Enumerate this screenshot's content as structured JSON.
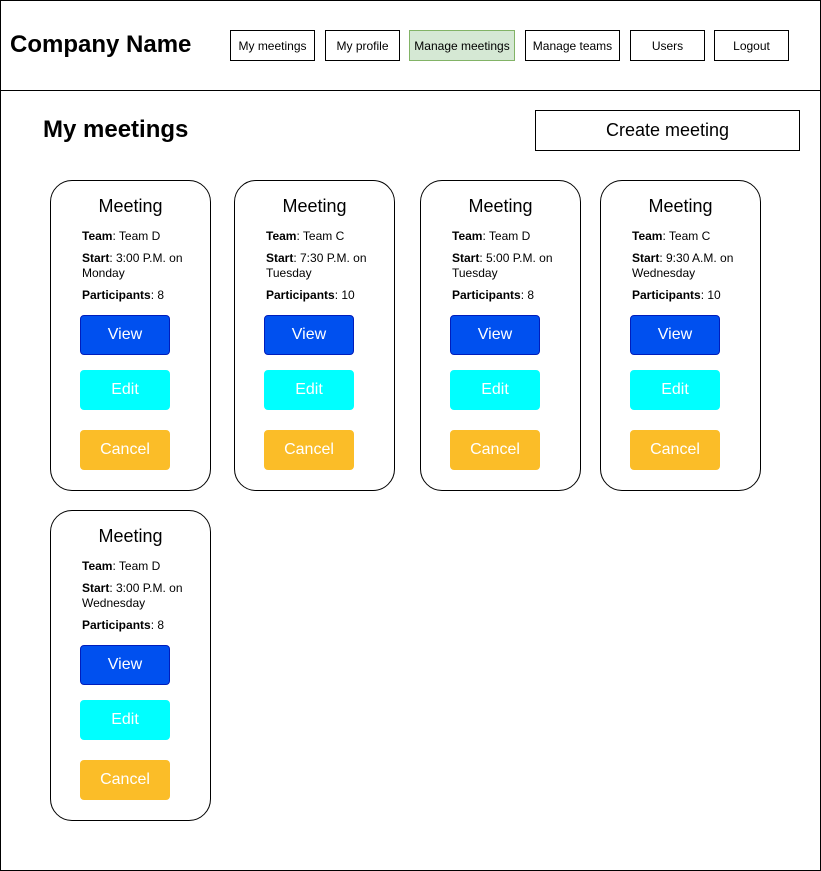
{
  "header": {
    "company_name": "Company Name",
    "nav": [
      {
        "label": "My meetings",
        "active": false
      },
      {
        "label": "My profile",
        "active": false
      },
      {
        "label": "Manage meetings",
        "active": true
      },
      {
        "label": "Manage teams",
        "active": false
      },
      {
        "label": "Users",
        "active": false
      },
      {
        "label": "Logout",
        "active": false
      }
    ]
  },
  "main": {
    "title": "My meetings",
    "create_label": "Create meeting",
    "labels": {
      "team": "Team",
      "start": "Start",
      "participants": "Participants"
    },
    "buttons": {
      "view": "View",
      "edit": "Edit",
      "cancel": "Cancel"
    },
    "meetings": [
      {
        "title": "Meeting",
        "team": ": Team D",
        "start": ": 3:00 P.M. on Monday",
        "participants": ": 8"
      },
      {
        "title": "Meeting",
        "team": ": Team C",
        "start": ": 7:30 P.M. on Tuesday",
        "participants": ": 10"
      },
      {
        "title": "Meeting",
        "team": ": Team D",
        "start": ": 5:00 P.M. on Tuesday",
        "participants": ": 8"
      },
      {
        "title": "Meeting",
        "team": ": Team C",
        "start": ": 9:30 A.M. on Wednesday",
        "participants": ": 10"
      },
      {
        "title": "Meeting",
        "team": ": Team D",
        "start": ": 3:00 P.M. on Wednesday",
        "participants": ": 8"
      }
    ]
  },
  "colors": {
    "view": "#0050ef",
    "edit": "#00ffff",
    "cancel": "#fbbd28",
    "active_nav": "#d5e8d4"
  }
}
